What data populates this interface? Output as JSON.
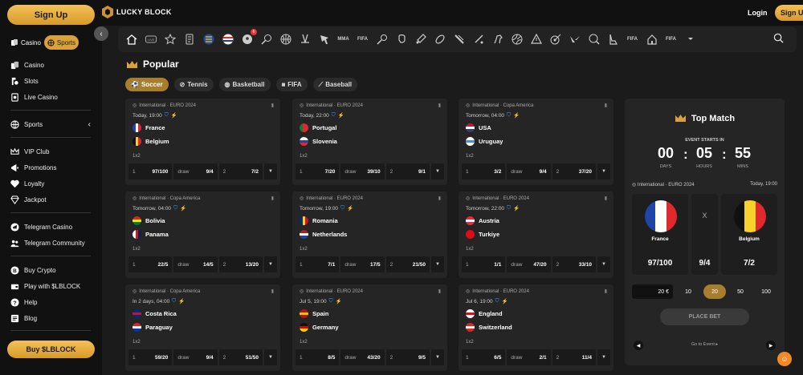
{
  "sidebar": {
    "signup_label": "Sign Up",
    "toggle": {
      "casino": "Casino",
      "sports": "Sports"
    },
    "items": [
      {
        "label": "Casino",
        "icon": "casino-icon"
      },
      {
        "label": "Slots",
        "icon": "slots-icon"
      },
      {
        "label": "Live Casino",
        "icon": "live-casino-icon"
      },
      {
        "label": "Sports",
        "icon": "sports-icon"
      },
      {
        "label": "VIP Club",
        "icon": "crown-icon"
      },
      {
        "label": "Promotions",
        "icon": "promotions-icon"
      },
      {
        "label": "Loyalty",
        "icon": "loyalty-icon"
      },
      {
        "label": "Jackpot",
        "icon": "diamond-icon"
      },
      {
        "label": "Telegram Casino",
        "icon": "telegram-icon"
      },
      {
        "label": "Telegram Community",
        "icon": "community-icon"
      },
      {
        "label": "Buy Crypto",
        "icon": "bitcoin-icon"
      },
      {
        "label": "Play with $LBLOCK",
        "icon": "wallet-icon"
      },
      {
        "label": "Help",
        "icon": "help-icon"
      },
      {
        "label": "Blog",
        "icon": "blog-icon"
      }
    ],
    "buy_label": "Buy $LBLOCK"
  },
  "header": {
    "logo_text": "LUCKY BLOCK",
    "login_label": "Login",
    "signup_label": "Sign Up"
  },
  "sportsbar": {
    "icons": [
      "home-icon",
      "live-icon",
      "favorites-icon",
      "betslip-icon",
      "euro-icon",
      "copa-icon",
      "soccer-icon",
      "tennis-icon",
      "basketball-icon",
      "hockey-icon",
      "esports-icon",
      "mma-icon",
      "fifa-icon",
      "badminton-icon",
      "boxing-icon",
      "cricket-icon",
      "american-football-icon",
      "snooker-icon",
      "table-tennis-icon",
      "horse-racing-icon",
      "volleyball-icon",
      "counter-strike-icon",
      "darts-icon",
      "valorant-icon",
      "ice-hockey-icon",
      "cycling-icon",
      "fifa-volta-icon",
      "golf-icon",
      "fifa-penalty-icon"
    ],
    "texts": {
      "mma": "MMA",
      "fifa": "FIFA",
      "fifa2": "FIFA",
      "fifa3": "FIFA"
    },
    "badge": "6"
  },
  "popular": {
    "title": "Popular",
    "tabs": [
      {
        "label": "Soccer",
        "active": true
      },
      {
        "label": "Tennis"
      },
      {
        "label": "Basketball"
      },
      {
        "label": "FIFA"
      },
      {
        "label": "Baseball"
      }
    ]
  },
  "matches": [
    {
      "league": "International · EURO 2024",
      "time": "Today, 19:00",
      "home": "France",
      "away": "Belgium",
      "market": "1x2",
      "o1": "97/100",
      "ox": "9/4",
      "o2": "7/2"
    },
    {
      "league": "International · EURO 2024",
      "time": "Today, 22:00",
      "home": "Portugal",
      "away": "Slovenia",
      "market": "1x2",
      "o1": "7/20",
      "ox": "39/10",
      "o2": "9/1"
    },
    {
      "league": "International · Copa America",
      "time": "Tomorrow, 04:00",
      "home": "USA",
      "away": "Uruguay",
      "market": "1x2",
      "o1": "3/2",
      "ox": "9/4",
      "o2": "37/20"
    },
    {
      "league": "International · Copa America",
      "time": "Tomorrow, 04:00",
      "home": "Bolivia",
      "away": "Panama",
      "market": "1x2",
      "o1": "22/5",
      "ox": "14/5",
      "o2": "13/20"
    },
    {
      "league": "International · EURO 2024",
      "time": "Tomorrow, 19:00",
      "home": "Romania",
      "away": "Netherlands",
      "market": "1x2",
      "o1": "7/1",
      "ox": "17/5",
      "o2": "21/50"
    },
    {
      "league": "International · EURO 2024",
      "time": "Tomorrow, 22:00",
      "home": "Austria",
      "away": "Turkiye",
      "market": "1x2",
      "o1": "1/1",
      "ox": "47/20",
      "o2": "33/10"
    },
    {
      "league": "International · Copa America",
      "time": "In 2 days, 04:00",
      "home": "Costa Rica",
      "away": "Paraguay",
      "market": "1x2",
      "o1": "59/20",
      "ox": "9/4",
      "o2": "51/50"
    },
    {
      "league": "International · EURO 2024",
      "time": "Jul 5, 19:00",
      "home": "Spain",
      "away": "Germany",
      "market": "1x2",
      "o1": "8/5",
      "ox": "43/20",
      "o2": "9/5"
    },
    {
      "league": "International · EURO 2024",
      "time": "Jul 6, 19:00",
      "home": "England",
      "away": "Switzerland",
      "market": "1x2",
      "o1": "6/5",
      "ox": "2/1",
      "o2": "11/4"
    }
  ],
  "odds_labels": {
    "home": "1",
    "draw": "draw",
    "away": "2"
  },
  "top_match": {
    "title": "Top Match",
    "event_starts": "EVENT STARTS IN",
    "days": "00",
    "hours": "05",
    "mins": "55",
    "days_label": "DAYS",
    "hours_label": "HOURS",
    "mins_label": "MINS",
    "colon": ":",
    "league": "International · EURO 2024",
    "date": "Today, 19:00",
    "home": "France",
    "away": "Belgium",
    "draw_symbol": "X",
    "o1": "97/100",
    "ox": "9/4",
    "o2": "7/2",
    "stake_value": "20 €",
    "stakes": [
      "10",
      "20",
      "50",
      "100"
    ],
    "place_bet": "PLACE BET",
    "goto": "Go to Event ▸"
  },
  "colors": {
    "accent": "#d9a13a",
    "background": "#1b1b1b",
    "card": "#252525"
  }
}
